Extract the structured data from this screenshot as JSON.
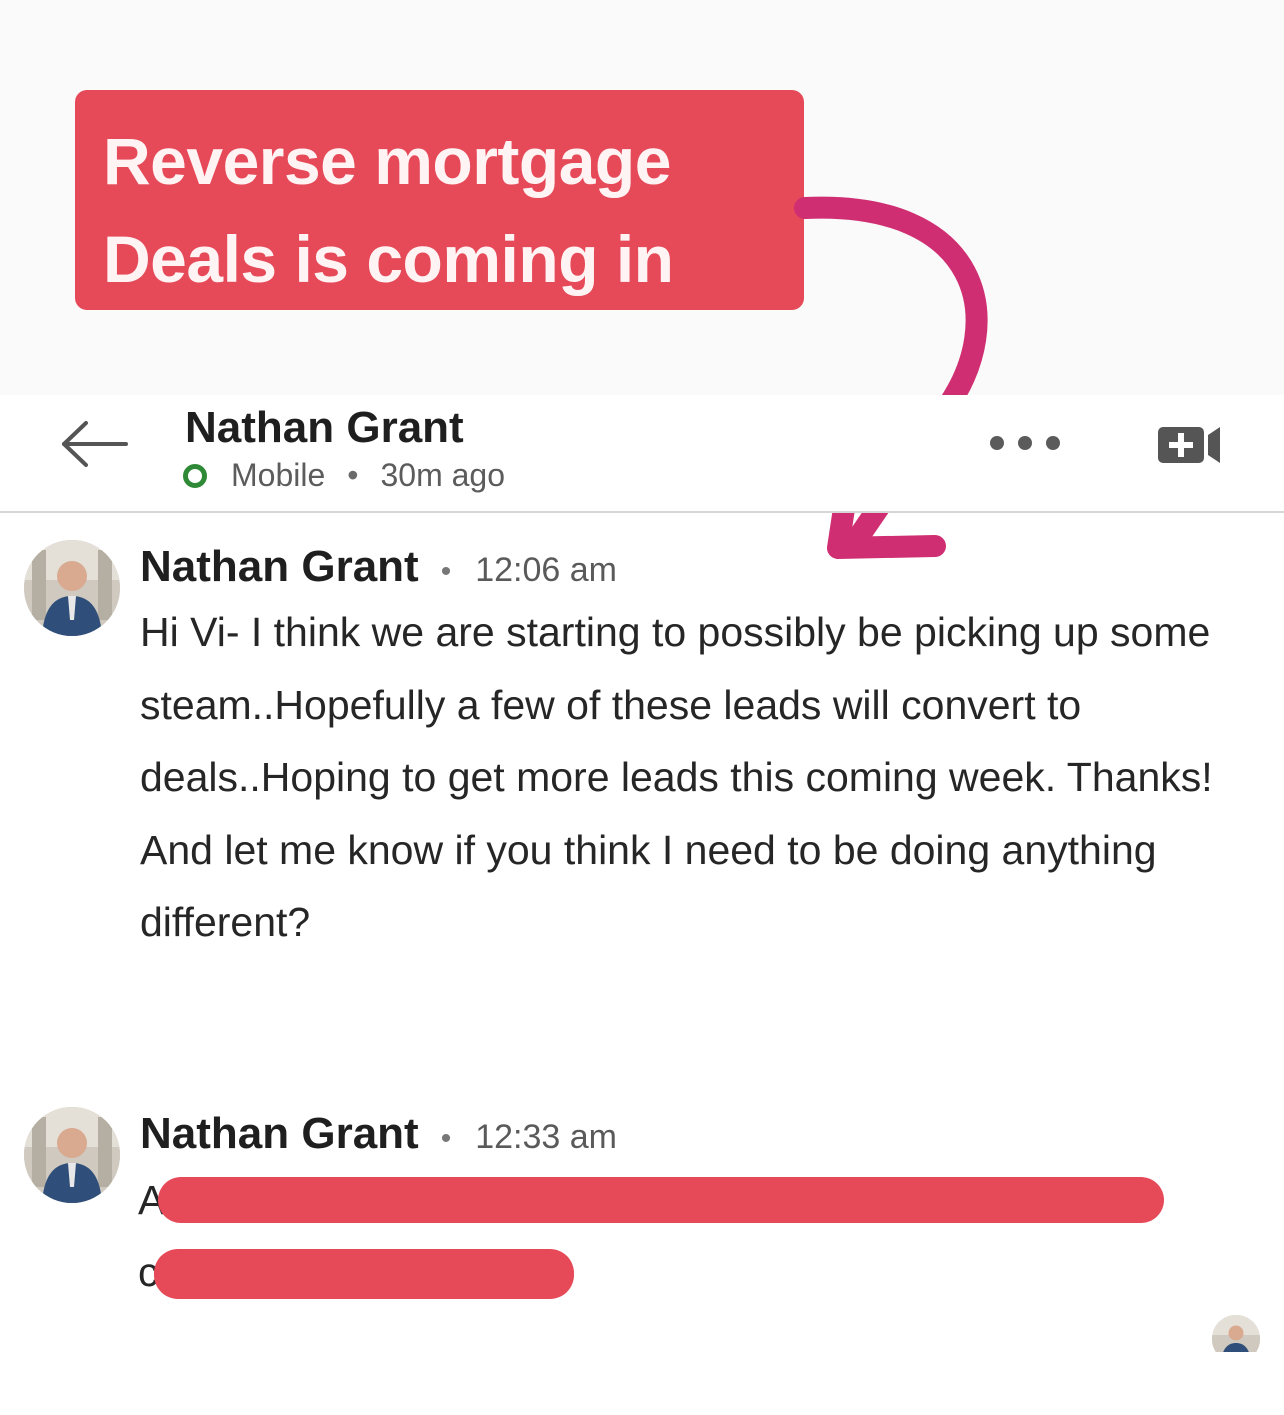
{
  "banner": {
    "line1": "Reverse mortgage",
    "line2": "Deals is coming in"
  },
  "header": {
    "name": "Nathan Grant",
    "status": "Mobile",
    "last_seen": "30m ago"
  },
  "messages": [
    {
      "sender": "Nathan Grant",
      "time": "12:06 am",
      "text": "Hi Vi- I think we are starting to possibly be picking up some steam..Hopefully a few of these leads will convert to deals..Hoping to get more leads this coming week. Thanks! And let me know if you think I need to be doing anything different?"
    },
    {
      "sender": "Nathan Grant",
      "time": "12:33 am",
      "first_char": "A",
      "second_line_char": "c",
      "redacted": true
    }
  ],
  "colors": {
    "banner": "#e64a59",
    "arrow": "#d02e72",
    "online": "#2f8a37"
  },
  "icons": {
    "back": "arrow-left-icon",
    "more": "ellipsis-icon",
    "video": "video-add-icon"
  }
}
